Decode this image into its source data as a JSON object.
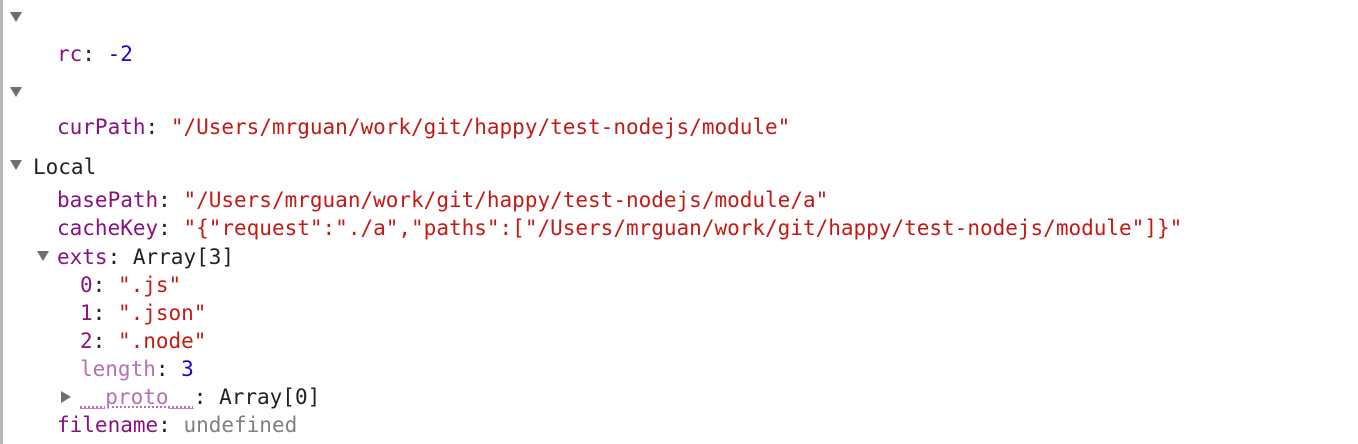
{
  "scope_1": {
    "key": "rc",
    "value": "-2"
  },
  "scope_2": {
    "key": "curPath",
    "value": "\"/Users/mrguan/work/git/happy/test-nodejs/module\""
  },
  "local": {
    "label": "Local",
    "basePath": {
      "key": "basePath",
      "value": "\"/Users/mrguan/work/git/happy/test-nodejs/module/a\""
    },
    "cacheKey": {
      "key": "cacheKey",
      "value": "\"{\"request\":\"./a\",\"paths\":[\"/Users/mrguan/work/git/happy/test-nodejs/module\"]}\""
    },
    "exts": {
      "key": "exts",
      "type": "Array[3]",
      "items": [
        {
          "index": "0",
          "value": "\".js\""
        },
        {
          "index": "1",
          "value": "\".json\""
        },
        {
          "index": "2",
          "value": "\".node\""
        }
      ],
      "length_key": "length",
      "length_value": "3",
      "proto_key": "__proto__",
      "proto_value": "Array[0]"
    },
    "filename": {
      "key": "filename",
      "value": "undefined"
    }
  },
  "colors": {
    "key": "#881280",
    "string": "#c41a16",
    "number": "#1c00cf",
    "undefined": "#808080",
    "triangle": "#6e6e6e"
  },
  "icons": {
    "expanded": "triangle-down-icon",
    "collapsed": "triangle-right-icon"
  }
}
